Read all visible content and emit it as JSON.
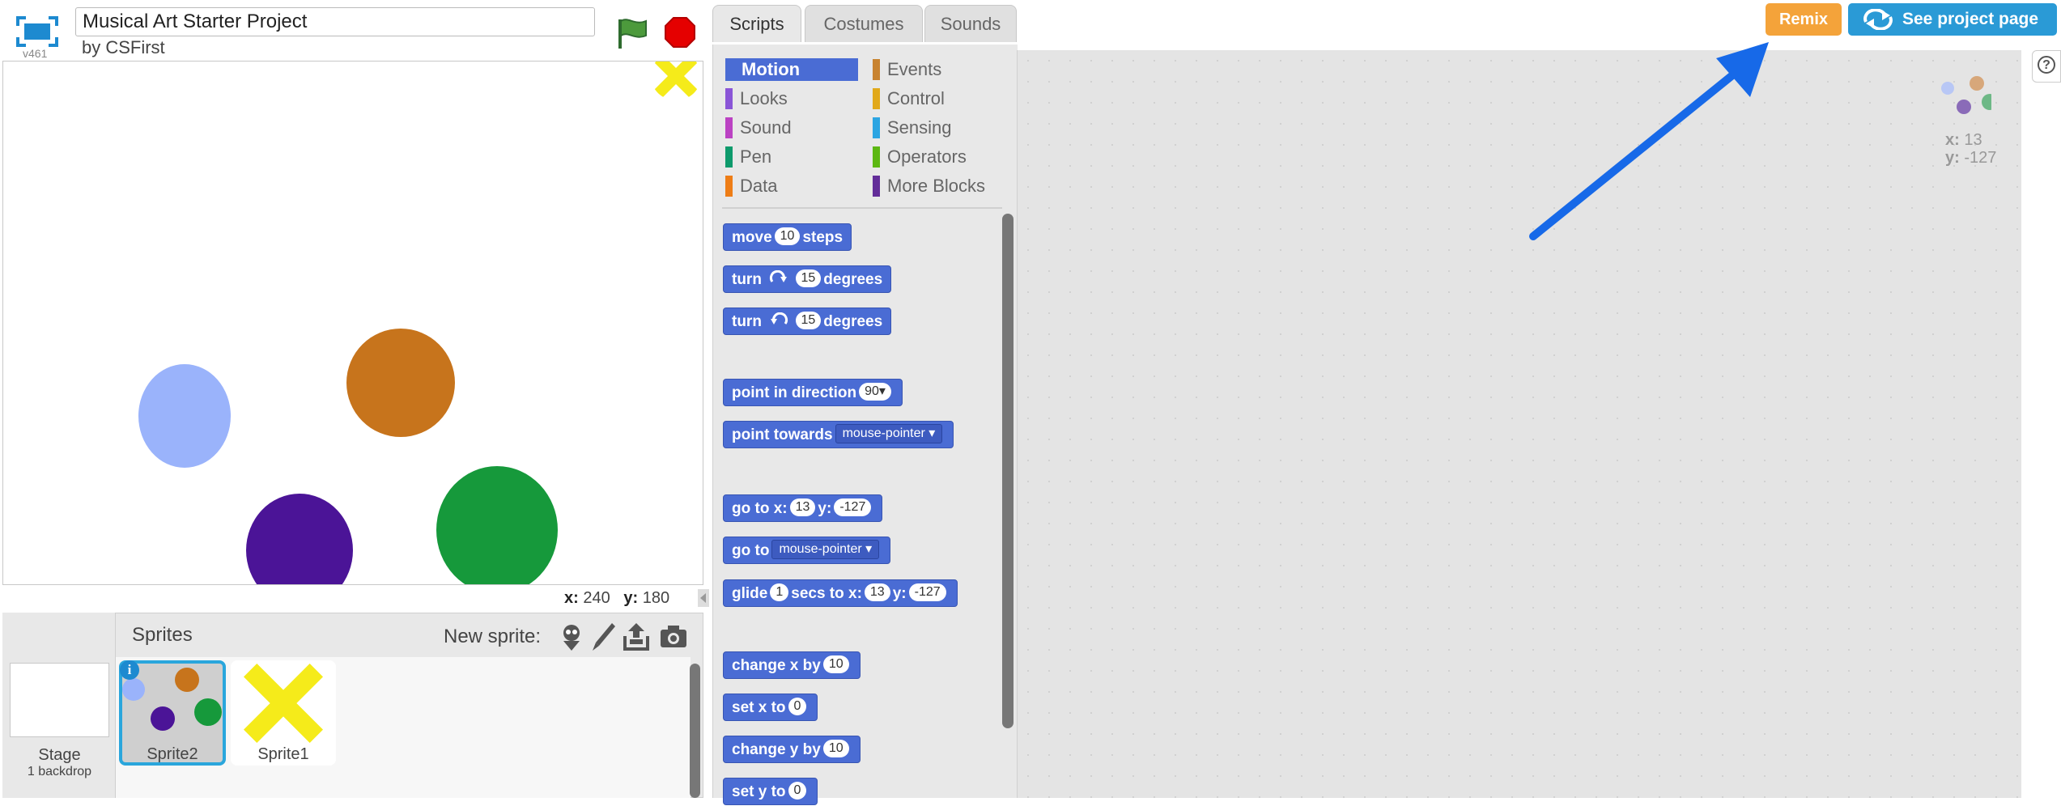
{
  "project": {
    "title": "Musical Art Starter Project",
    "author": "by CSFirst",
    "version": "v461"
  },
  "stage": {
    "coords": {
      "x_label": "x:",
      "x_value": "240",
      "y_label": "y:",
      "y_value": "180"
    }
  },
  "sprites_pane": {
    "title": "Sprites",
    "new_sprite_label": "New sprite:",
    "stage_label": "Stage",
    "backdrop_label": "1 backdrop",
    "sprites": [
      {
        "name": "Sprite2",
        "selected": true
      },
      {
        "name": "Sprite1",
        "selected": false
      }
    ]
  },
  "tabs": [
    "Scripts",
    "Costumes",
    "Sounds"
  ],
  "categories": [
    {
      "label": "Motion",
      "color": "#4a6cd4",
      "selected": true
    },
    {
      "label": "Looks",
      "color": "#8a55d7"
    },
    {
      "label": "Sound",
      "color": "#bb42c3"
    },
    {
      "label": "Pen",
      "color": "#0e9a6c"
    },
    {
      "label": "Data",
      "color": "#ee7d16"
    },
    {
      "label": "Events",
      "color": "#c88330"
    },
    {
      "label": "Control",
      "color": "#e1a91a"
    },
    {
      "label": "Sensing",
      "color": "#2ca5e2"
    },
    {
      "label": "Operators",
      "color": "#5cb712"
    },
    {
      "label": "More Blocks",
      "color": "#632d99"
    }
  ],
  "blocks": {
    "move": {
      "a": "move",
      "v": "10",
      "b": "steps"
    },
    "turn_right": {
      "a": "turn",
      "v": "15",
      "b": "degrees"
    },
    "turn_left": {
      "a": "turn",
      "v": "15",
      "b": "degrees"
    },
    "point_dir": {
      "a": "point in direction",
      "v": "90▾"
    },
    "point_towards": {
      "a": "point towards",
      "v": "mouse-pointer ▾"
    },
    "goto_xy": {
      "a": "go to x:",
      "x": "13",
      "b": "y:",
      "y": "-127"
    },
    "goto": {
      "a": "go to",
      "v": "mouse-pointer ▾"
    },
    "glide": {
      "a": "glide",
      "s": "1",
      "b": "secs to x:",
      "x": "13",
      "c": "y:",
      "y": "-127"
    },
    "change_x": {
      "a": "change x by",
      "v": "10"
    },
    "set_x": {
      "a": "set x to",
      "v": "0"
    },
    "change_y": {
      "a": "change y by",
      "v": "10"
    },
    "set_y": {
      "a": "set y to",
      "v": "0"
    }
  },
  "script_area": {
    "x_label": "x:",
    "x_value": "13",
    "y_label": "y:",
    "y_value": "-127"
  },
  "buttons": {
    "remix": "Remix",
    "see_project": "See project page",
    "help": "?"
  },
  "colors": {
    "accent_blue": "#2a9ad6",
    "remix_orange": "#f4a33a",
    "motion_blue": "#4a6cd4",
    "annotation_arrow": "#1769e8"
  }
}
